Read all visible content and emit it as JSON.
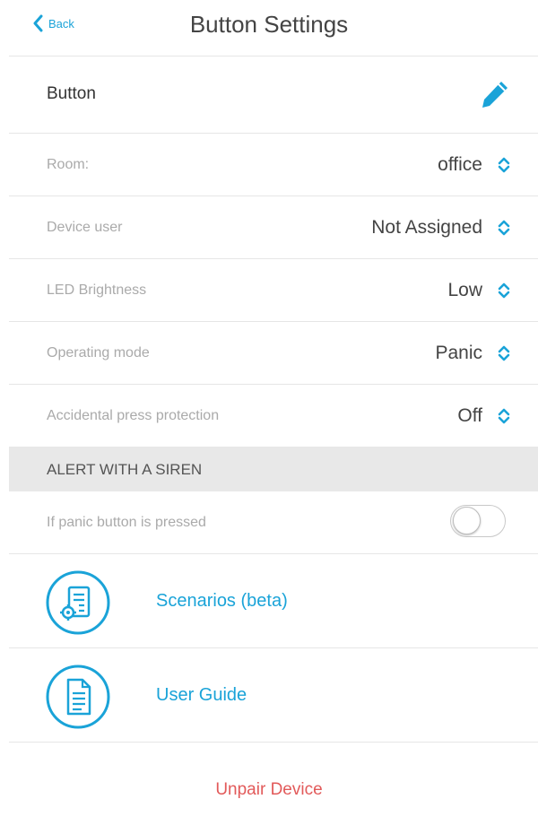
{
  "header": {
    "back_label": "Back",
    "title": "Button Settings"
  },
  "device": {
    "name": "Button"
  },
  "settings": [
    {
      "label": "Room:",
      "value": "office"
    },
    {
      "label": "Device user",
      "value": "Not Assigned"
    },
    {
      "label": "LED Brightness",
      "value": "Low"
    },
    {
      "label": "Operating mode",
      "value": "Panic"
    },
    {
      "label": "Accidental press protection",
      "value": "Off"
    }
  ],
  "alert_section": {
    "title": "ALERT WITH A SIREN",
    "toggle_label": "If panic button is pressed",
    "toggle_on": false
  },
  "links": [
    {
      "label": "Scenarios (beta)",
      "icon": "scenarios-icon"
    },
    {
      "label": "User Guide",
      "icon": "document-icon"
    }
  ],
  "footer": {
    "unpair_label": "Unpair Device"
  },
  "colors": {
    "accent": "#1aa3d8",
    "danger": "#e25a5a",
    "section_bg": "#e8e8e8"
  }
}
